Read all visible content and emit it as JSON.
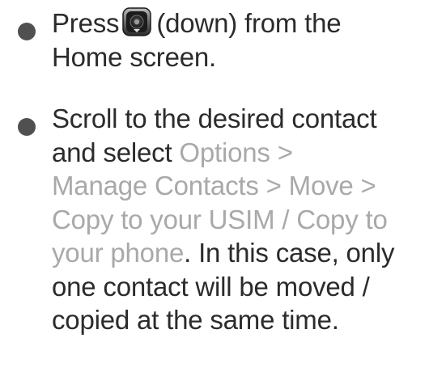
{
  "steps": [
    {
      "lines": [
        [
          "Press",
          "(down) from the"
        ],
        [
          "Home screen."
        ]
      ],
      "icon": "navigation-key-down-icon"
    },
    {
      "lines": [
        [
          "Scroll to the desired contact"
        ],
        [
          "and select ",
          "Options >"
        ],
        [
          "Manage Contacts > Move >"
        ],
        [
          "Copy to your USIM / Copy to"
        ],
        [
          "your phone",
          ". In this case, only"
        ],
        [
          "one contact will be moved /"
        ],
        [
          "copied at the same time."
        ]
      ]
    }
  ],
  "colors": {
    "body_text": "#2b2b2b",
    "menu_text": "#a9a9a9",
    "bullet": "#505050"
  }
}
